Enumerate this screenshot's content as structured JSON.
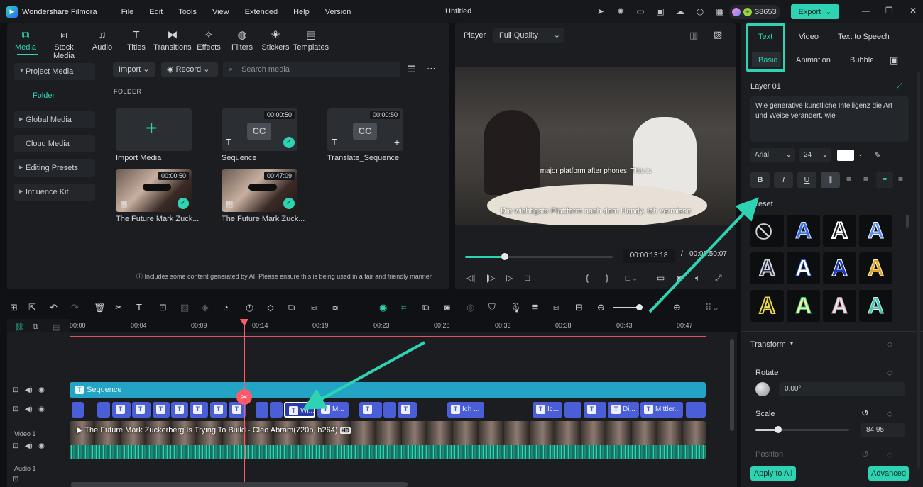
{
  "app": {
    "name": "Wondershare Filmora",
    "menu": [
      "File",
      "Edit",
      "Tools",
      "View",
      "Extended",
      "Help",
      "Version"
    ],
    "doc_title": "Untitled",
    "credits": "38653",
    "export_label": "Export"
  },
  "media": {
    "tabs": [
      "Media",
      "Stock Media",
      "Audio",
      "Titles",
      "Transitions",
      "Effects",
      "Filters",
      "Stickers",
      "Templates"
    ],
    "sidebar": [
      "Project Media",
      "Folder",
      "Global Media",
      "Cloud Media",
      "Editing Presets",
      "Influence Kit"
    ],
    "import_label": "Import",
    "record_label": "Record",
    "search_placeholder": "Search media",
    "folder_heading": "FOLDER",
    "items": [
      {
        "label": "Import Media",
        "duration": ""
      },
      {
        "label": "Sequence",
        "duration": "00:00:50"
      },
      {
        "label": "Translate_Sequence",
        "duration": "00:00:50"
      },
      {
        "label": "The Future Mark Zuck...",
        "duration": "00:00:50"
      },
      {
        "label": "The Future Mark Zuck...",
        "duration": "00:47:09"
      }
    ],
    "ai_note": "Includes some content generated by AI. Please ensure this is being used in a fair and friendly manner."
  },
  "player": {
    "label": "Player",
    "quality": "Full Quality",
    "subtitle_top": "major platform after phones. This is",
    "subtitle_bottom": "Die wichtigste Plattform nach dem Handy. Ich vermisse",
    "current_time": "00:00:13:18",
    "separator": "/",
    "total_time": "00:00:50:07",
    "progress": 0.27
  },
  "props": {
    "tabs": [
      "Text",
      "Video",
      "Text to Speech"
    ],
    "subtabs": [
      "Basic",
      "Animation",
      "Bubble"
    ],
    "layer": "Layer 01",
    "text_value": "Wie generative künstliche Intelligenz die Art und Weise verändert, wie",
    "font": "Arial",
    "size": "24",
    "text_color": "#ffffff",
    "preset_label": "Preset",
    "transform_label": "Transform",
    "rotate_label": "Rotate",
    "rotate_value": "0.00°",
    "scale_label": "Scale",
    "scale_value": "84.95",
    "position_label": "Position",
    "apply_all": "Apply to All",
    "advanced": "Advanced"
  },
  "timeline": {
    "ticks": [
      "00:00",
      "00:04",
      "00:09",
      "00:14",
      "00:19",
      "00:23",
      "00:28",
      "00:33",
      "00:38",
      "00:43",
      "00:47"
    ],
    "sequence_label": "Sequence",
    "video_track_label": "Video 1",
    "audio_track_label": "Audio 1",
    "video_clip_title": "The Future Mark Zuckerberg Is Trying To Build - Cleo Abram(720p, h264)",
    "hd_badge": "HD",
    "text_clips": [
      "Wi...",
      "M...",
      "Ich ...",
      "Ic...",
      "Di...",
      "Mittler..."
    ]
  },
  "colors": {
    "accent": "#2ed3b4",
    "playhead": "#ff5a6a",
    "text_clip": "#4a5ed8",
    "sequence": "#24a4c4"
  }
}
